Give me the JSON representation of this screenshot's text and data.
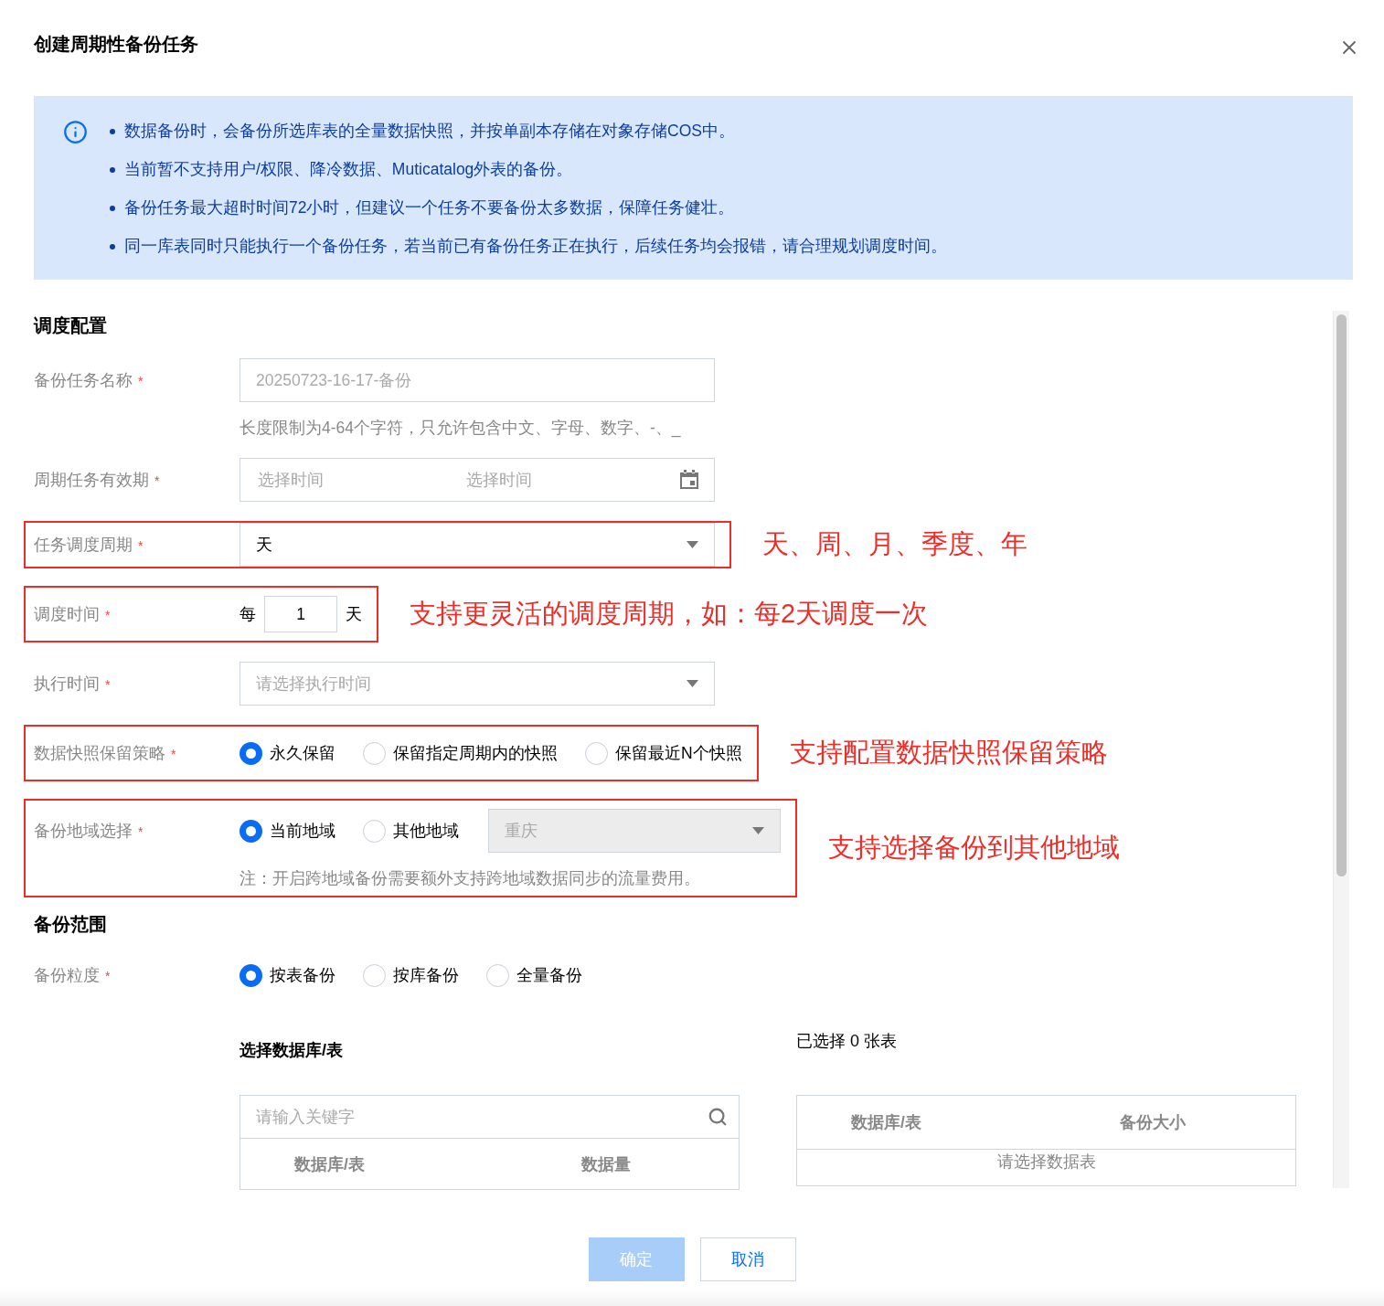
{
  "dialog": {
    "title": "创建周期性备份任务"
  },
  "notice": {
    "items": [
      "数据备份时，会备份所选库表的全量数据快照，并按单副本存储在对象存储COS中。",
      "当前暂不支持用户/权限、降冷数据、Muticatalog外表的备份。",
      "备份任务最大超时时间72小时，但建议一个任务不要备份太多数据，保障任务健壮。",
      "同一库表同时只能执行一个备份任务，若当前已有备份任务正在执行，后续任务均会报错，请合理规划调度时间。"
    ]
  },
  "sections": [
    {
      "title": "调度配置",
      "fields": [
        {
          "kind": "input",
          "label": "备份任务名称",
          "mark": "*",
          "placeholder": "20250723-16-17-备份",
          "hint": "长度限制为4-64个字符，只允许包含中文、字母、数字、-、_",
          "highlighted": false
        },
        {
          "kind": "daterange",
          "label": "周期任务有效期",
          "mark": "*",
          "placeholders": [
            "选择时间",
            "选择时间"
          ],
          "highlighted": false
        },
        {
          "kind": "select",
          "label": "任务调度周期",
          "mark": "*",
          "value": "天",
          "highlighted": true,
          "annotation": "天、周、月、季度、年"
        },
        {
          "kind": "interval",
          "label": "调度时间",
          "mark": "*",
          "prefix": "每",
          "value": "1",
          "suffix": "天",
          "highlighted": true,
          "annotation": "支持更灵活的调度周期，如：每2天调度一次"
        },
        {
          "kind": "select",
          "label": "执行时间",
          "mark": "*",
          "placeholder": "请选择执行时间",
          "highlighted": false
        },
        {
          "kind": "radio",
          "label": "数据快照保留策略",
          "mark": "*",
          "options": [
            {
              "label": "永久保留",
              "selected": true
            },
            {
              "label": "保留指定周期内的快照",
              "selected": false
            },
            {
              "label": "保留最近N个快照",
              "selected": false
            }
          ],
          "highlighted": true,
          "annotation": "支持配置数据快照保留策略"
        },
        {
          "kind": "radio",
          "label": "备份地域选择",
          "mark": "*",
          "options": [
            {
              "label": "当前地域",
              "selected": true
            },
            {
              "label": "其他地域",
              "selected": false
            }
          ],
          "select": {
            "value": "重庆",
            "disabled": true
          },
          "note": "注：开启跨地域备份需要额外支持跨地域数据同步的流量费用。",
          "highlighted": true,
          "annotation": "支持选择备份到其他地域"
        }
      ]
    },
    {
      "title": "备份范围",
      "fields": [
        {
          "kind": "radio",
          "label": "备份粒度",
          "mark": "*",
          "options": [
            {
              "label": "按表备份",
              "selected": true
            },
            {
              "label": "按库备份",
              "selected": false
            },
            {
              "label": "全量备份",
              "selected": false
            }
          ],
          "highlighted": false
        }
      ],
      "picker": {
        "left": {
          "title": "选择数据库/表",
          "search_placeholder": "请输入关键字",
          "columns": [
            "数据库/表",
            "数据量"
          ]
        },
        "right": {
          "title": "已选择 0 张表",
          "columns": [
            "数据库/表",
            "备份大小"
          ],
          "empty_text": "请选择数据表"
        }
      }
    }
  ],
  "footer": {
    "buttons": [
      {
        "label": "确定",
        "kind": "primary",
        "disabled": true
      },
      {
        "label": "取消",
        "kind": "secondary",
        "disabled": false
      }
    ]
  }
}
